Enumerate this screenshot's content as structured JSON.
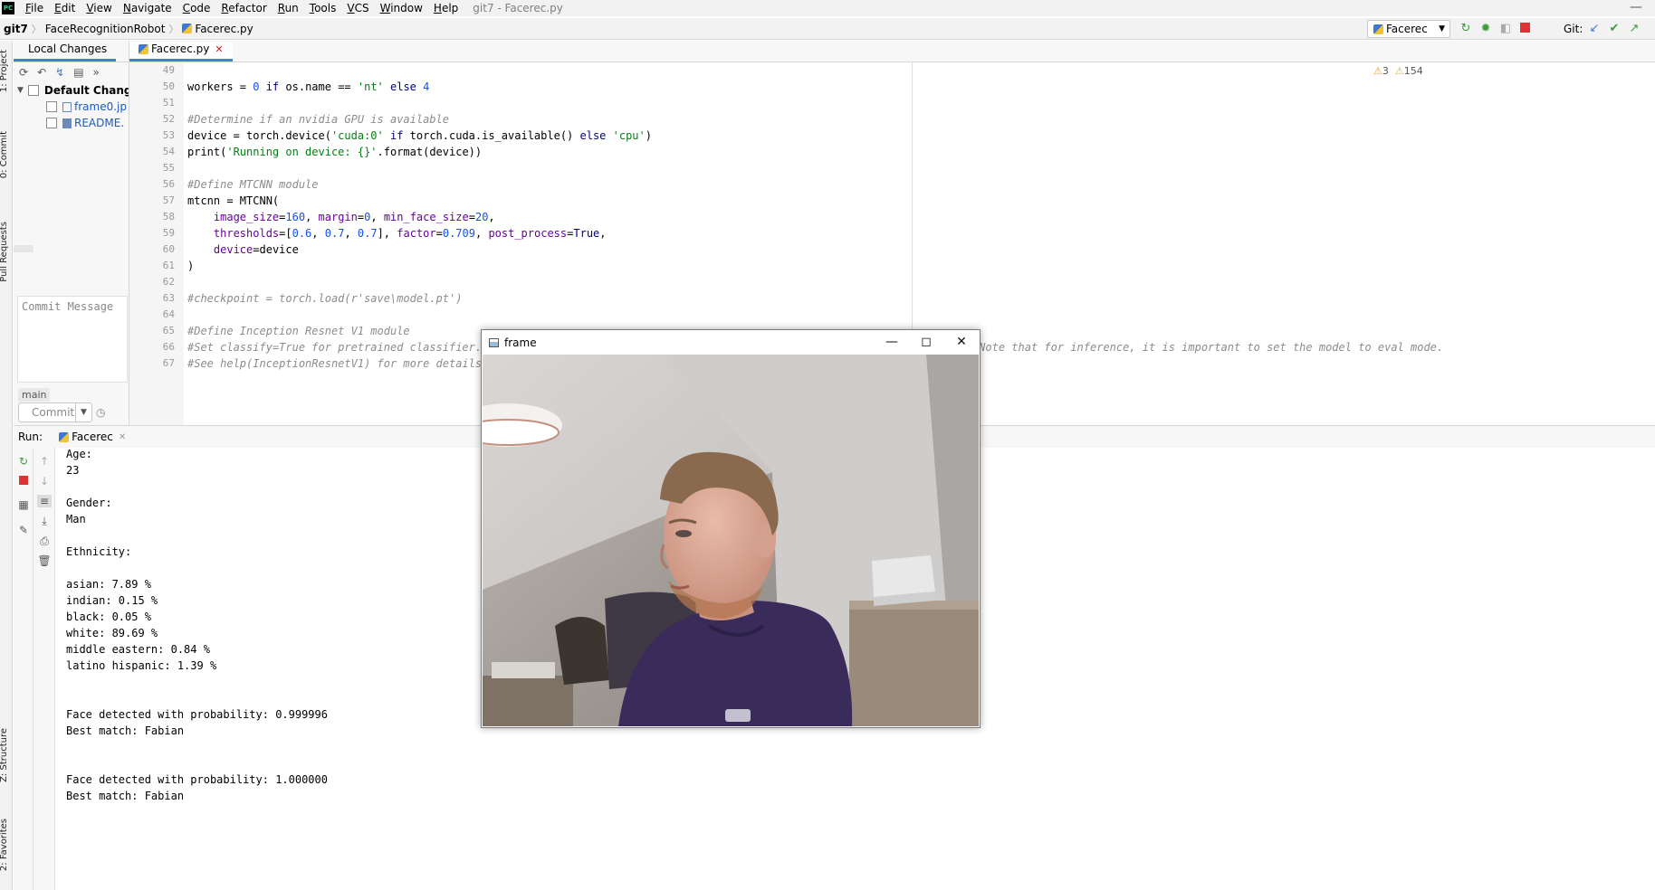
{
  "menubar": {
    "logo": "PC",
    "items": [
      "File",
      "Edit",
      "View",
      "Navigate",
      "Code",
      "Refactor",
      "Run",
      "Tools",
      "VCS",
      "Window",
      "Help"
    ],
    "window_title": "git7 - Facerec.py",
    "minimize_glyph": "—"
  },
  "navbar": {
    "crumbs": [
      "git7",
      "FaceRecognitionRobot",
      "Facerec.py"
    ],
    "separator": "〉",
    "run_config": "Facerec",
    "git_label": "Git:"
  },
  "left_strip": {
    "tabs": [
      "1: Project",
      "0: Commit",
      "Pull Requests",
      "Z: Structure",
      "2: Favorites"
    ]
  },
  "commit_panel": {
    "tab": "Local Changes",
    "group": "Default Change",
    "files": [
      "frame0.jp",
      "README."
    ],
    "message_placeholder": "Commit Message",
    "branch": "main",
    "commit_button": "Commit"
  },
  "editor": {
    "tab": "Facerec.py",
    "line_numbers": [
      "49",
      "50",
      "51",
      "52",
      "53",
      "54",
      "55",
      "56",
      "57",
      "58",
      "59",
      "60",
      "61",
      "62",
      "63",
      "64",
      "65",
      "66",
      "67"
    ],
    "warnings": "3",
    "weak_warnings": "154"
  },
  "run_panel": {
    "label": "Run:",
    "tab": "Facerec",
    "output": [
      "Age:",
      "23",
      "",
      "Gender:",
      "Man",
      "",
      "Ethnicity:",
      "",
      "asian: 7.89 %",
      "indian: 0.15 %",
      "black: 0.05 %",
      "white: 89.69 %",
      "middle eastern: 0.84 %",
      "latino hispanic: 1.39 %",
      "",
      "",
      "Face detected with probability: 0.999996",
      "Best match: Fabian",
      "",
      "",
      "Face detected with probability: 1.000000",
      "Best match: Fabian"
    ]
  },
  "frame_window": {
    "title": "frame"
  },
  "colors": {
    "accent": "#4083c9",
    "keyword": "#000080",
    "number": "#1750eb",
    "string": "#067d17",
    "comment": "#8c8c8c",
    "param": "#660099"
  }
}
